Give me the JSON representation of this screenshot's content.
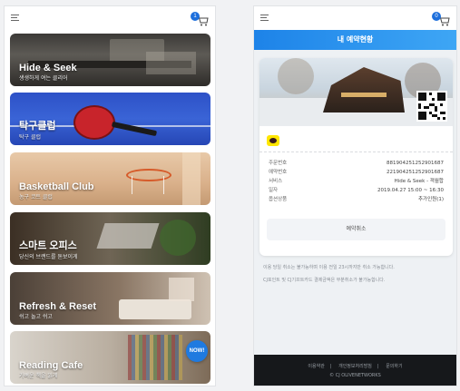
{
  "left": {
    "cart_badge": "1",
    "cards": [
      {
        "title": "Hide & Seek",
        "sub": "생생하게 여는 클리어"
      },
      {
        "title": "탁구클럽",
        "sub": "탁구 클럽"
      },
      {
        "title": "Basketball Club",
        "sub": "농구 코트 클럽"
      },
      {
        "title": "스마트 오피스",
        "sub": "당신의 브랜드를 돋보이게"
      },
      {
        "title": "Refresh & Reset",
        "sub": "쉬고 놀고 쉬고"
      },
      {
        "title": "Reading Cafe",
        "sub": "가벼운 책을 읽게"
      }
    ],
    "now_label": "NOW!"
  },
  "right": {
    "cart_badge": "0",
    "header_title": "내 예약현황",
    "rows": [
      {
        "label": "주문번호",
        "value": "881904251252901687"
      },
      {
        "label": "예약번호",
        "value": "221904251252901687"
      },
      {
        "label": "서비스",
        "value": "Hide & Seek - 객월합"
      },
      {
        "label": "일자",
        "value": "2019.04.27 15:00 ~ 16:30"
      },
      {
        "label": "옵션상품",
        "value": "추가인원(1)"
      }
    ],
    "cancel_label": "예약취소",
    "notice1": "이용 당일 취소는 불가능하며 이용 전일 23시까지만 취소 가능합니다.",
    "notice2": "CJ포인트 및 CJ기프트카드 결제금액은 부분취소가 불가능합니다.",
    "footer_links": [
      "이용약관",
      "개인정보처리방침",
      "문의하기"
    ],
    "copyright": "© CJ OLIVENETWORKS"
  },
  "colors": {
    "accent": "#1d83e8",
    "now_badge": "#1f7ae0",
    "kakao": "#ffe600",
    "footer": "#16181b"
  }
}
